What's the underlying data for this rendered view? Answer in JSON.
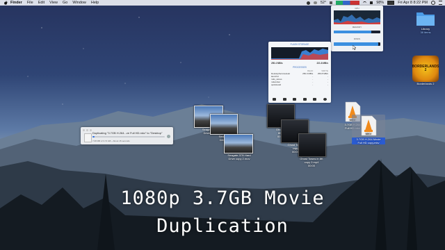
{
  "menubar": {
    "app": "Finder",
    "menus": [
      "File",
      "Edit",
      "View",
      "Go",
      "Window",
      "Help"
    ],
    "temperature": "52°",
    "battery": "98%",
    "datetime": "Fri Apr 8  8:22 PM"
  },
  "stats_panel": {
    "cpu_label": "CPU",
    "memory_label": "MEMORY",
    "disks_label": "DISKS",
    "memory_fill": 0.8,
    "disk_fill": 0.95
  },
  "flash_storage": {
    "title": "FLASH STORAGE",
    "read_rate": "250.4 MB/s",
    "write_rate": "221.8 MB/s",
    "processes_title": "PROCESSES",
    "headers": [
      "",
      "READ",
      "WRITE"
    ],
    "rows": [
      [
        "DesktopServicesHel",
        "250.0 MB/s",
        "259.8 MB/s"
      ],
      [
        "launchd",
        "-",
        "-"
      ],
      [
        "mds_stores",
        "-",
        "-"
      ],
      [
        "mdworker",
        "-",
        "-"
      ],
      [
        "quicklookd",
        "-",
        "-"
      ]
    ]
  },
  "desktop": {
    "library": {
      "label": "Library",
      "sub": "38 items"
    },
    "borderlands": {
      "label": "Borderlands 2",
      "art": "BORDERLANDS 2"
    },
    "seagate1": {
      "label1": "Seagate 3",
      "label2": "Drive ca"
    },
    "seagate2": {
      "label1": "Seagate",
      "label2": "Drive c"
    },
    "seagate3": {
      "label1": "Seagate 3TB Hard",
      "label2": "Drive copy 2.mov"
    },
    "ghost1": {
      "label1": "Ghost T",
      "label2": "8K.1",
      "label3": "00:00"
    },
    "ghost2": {
      "label1": "Ghost Towns",
      "label2": "copy",
      "label3": "00:00"
    },
    "ghost3": {
      "label1": "Ghost Towns in 8K",
      "label2": "copy 2.mp4",
      "label3": "00:00"
    },
    "movie1": {
      "label1": "3.7GB H.264",
      "label2": "Full HD.mkv",
      "badge": "MKV"
    },
    "movie2": {
      "label1": "3.7GB H.264 Movie",
      "label2": "Full HD copy.mkv",
      "badge": "MKV"
    }
  },
  "copy_dialog": {
    "title": "Duplicating \"3.7GB H.264...ve Full HD.mkv\" to \"Desktop\"",
    "detail": "7.08 MB of 3.74 GB – About 15 seconds",
    "progress": 0.03
  },
  "caption": {
    "line1": "1080p 3.7GB Movie",
    "line2": "Duplication"
  }
}
